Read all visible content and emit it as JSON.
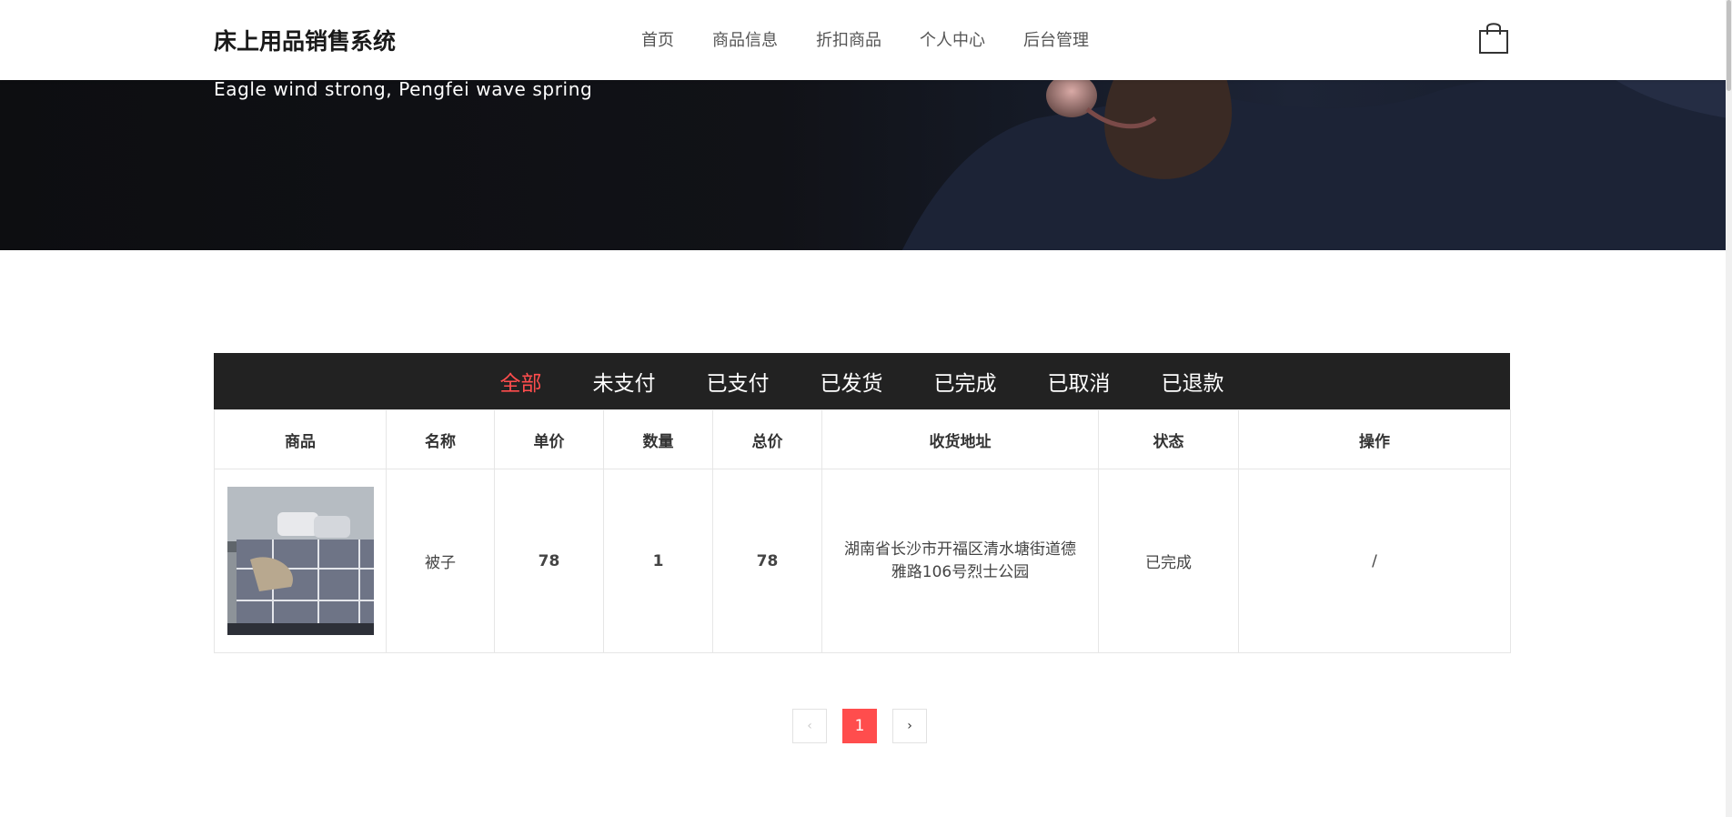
{
  "header": {
    "brand": "床上用品销售系统",
    "nav": [
      "首页",
      "商品信息",
      "折扣商品",
      "个人中心",
      "后台管理"
    ],
    "cart_icon": "shopping-bag-icon"
  },
  "hero": {
    "subtitle": "Eagle wind strong, Pengfei wave spring"
  },
  "orders": {
    "tabs": [
      "全部",
      "未支付",
      "已支付",
      "已发货",
      "已完成",
      "已取消",
      "已退款"
    ],
    "active_tab": "全部",
    "columns": [
      "商品",
      "名称",
      "单价",
      "数量",
      "总价",
      "收货地址",
      "状态",
      "操作"
    ],
    "rows": [
      {
        "name": "被子",
        "unit_price": "78",
        "quantity": "1",
        "total": "78",
        "address": "湖南省长沙市开福区清水塘街道德雅路106号烈士公园",
        "status": "已完成",
        "action": "/"
      }
    ]
  },
  "pagination": {
    "prev_label": "‹",
    "current": "1",
    "next_label": "›"
  },
  "colors": {
    "accent": "#ff4d4d",
    "tab_bar": "#222222"
  }
}
